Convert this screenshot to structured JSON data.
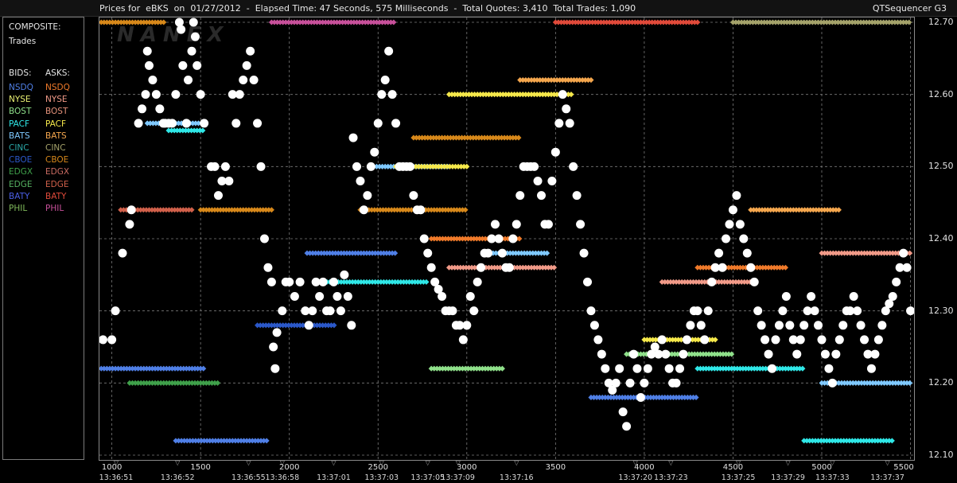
{
  "title": {
    "left": "Prices for  eBKS  on  01/27/2012  -  Elapsed Time: 47 Seconds, 575 Milliseconds  -  Total Quotes: 3,410  Total Trades: 1,090",
    "right": "QTSequencer G3"
  },
  "legend": {
    "composite_label": "COMPOSITE:",
    "trades_label": "Trades",
    "bids_header": "BIDS:",
    "asks_header": "ASKS:",
    "exchanges": [
      {
        "bid": "NSDQ",
        "ask": "NSDQ",
        "bid_color": "#4f7fe6",
        "ask_color": "#f07a2a"
      },
      {
        "bid": "NYSE",
        "ask": "NYSE",
        "bid_color": "#e9ef72",
        "ask_color": "#f19a88"
      },
      {
        "bid": "BOST",
        "ask": "BOST",
        "bid_color": "#8fe08a",
        "ask_color": "#e4917a"
      },
      {
        "bid": "PACF",
        "ask": "PACF",
        "bid_color": "#2fe7e7",
        "ask_color": "#f5e84a"
      },
      {
        "bid": "BATS",
        "ask": "BATS",
        "bid_color": "#7fc9ff",
        "ask_color": "#f4a64d"
      },
      {
        "bid": "CINC",
        "ask": "CINC",
        "bid_color": "#2aa6a6",
        "ask_color": "#a4a26a"
      },
      {
        "bid": "CBOE",
        "ask": "CBOE",
        "bid_color": "#2b58c9",
        "ask_color": "#d7881a"
      },
      {
        "bid": "EDGX",
        "ask": "EDGX",
        "bid_color": "#3fa04a",
        "ask_color": "#c96b62"
      },
      {
        "bid": "EDGE",
        "ask": "EDGE",
        "bid_color": "#55b060",
        "ask_color": "#d0604a"
      },
      {
        "bid": "BATY",
        "ask": "BATY",
        "bid_color": "#4a5fe6",
        "ask_color": "#e04a3a"
      },
      {
        "bid": "PHIL",
        "ask": "PHIL",
        "bid_color": "#7fb85a",
        "ask_color": "#c7509a"
      }
    ]
  },
  "chart_data": {
    "type": "scatter",
    "title": "",
    "y_tick_labels": [
      "12.70",
      "12.60",
      "12.50",
      "12.40",
      "12.30",
      "12.20",
      "12.10"
    ],
    "ylim": [
      12.1,
      12.7
    ],
    "xlim": [
      930,
      5520
    ],
    "x_ticks": [
      1000,
      1500,
      2000,
      2500,
      3000,
      3500,
      4000,
      4500,
      5000,
      5500
    ],
    "x_tick_labels": [
      "1000",
      "1500",
      "2000",
      "2500",
      "3000",
      "3500",
      "4000",
      "4500",
      "5000",
      "5500"
    ],
    "time_labels": [
      {
        "x": 1000,
        "label": "13:36:51"
      },
      {
        "x": 1370,
        "label": "13:36:52"
      },
      {
        "x": 1770,
        "label": "13:36:55"
      },
      {
        "x": 1960,
        "label": "13:36:58"
      },
      {
        "x": 2250,
        "label": "13:37:01"
      },
      {
        "x": 2520,
        "label": "13:37:03"
      },
      {
        "x": 2780,
        "label": "13:37:05"
      },
      {
        "x": 2950,
        "label": "13:37:09"
      },
      {
        "x": 3280,
        "label": "13:37:16"
      },
      {
        "x": 3950,
        "label": "13:37:20"
      },
      {
        "x": 4150,
        "label": "13:37:23"
      },
      {
        "x": 4530,
        "label": "13:37:25"
      },
      {
        "x": 4810,
        "label": "13:37:29"
      },
      {
        "x": 5060,
        "label": "13:37:33"
      },
      {
        "x": 5370,
        "label": "13:37:37"
      }
    ],
    "grid": true,
    "legend_placement": "left-panel",
    "trade_color": "#ffffff",
    "trades": [
      [
        950,
        12.26
      ],
      [
        1000,
        12.26
      ],
      [
        1020,
        12.3
      ],
      [
        1060,
        12.38
      ],
      [
        1100,
        12.42
      ],
      [
        1110,
        12.44
      ],
      [
        1150,
        12.56
      ],
      [
        1170,
        12.58
      ],
      [
        1190,
        12.6
      ],
      [
        1200,
        12.66
      ],
      [
        1210,
        12.64
      ],
      [
        1230,
        12.62
      ],
      [
        1250,
        12.6
      ],
      [
        1270,
        12.58
      ],
      [
        1290,
        12.56
      ],
      [
        1300,
        12.56
      ],
      [
        1320,
        12.56
      ],
      [
        1340,
        12.56
      ],
      [
        1360,
        12.6
      ],
      [
        1380,
        12.7
      ],
      [
        1390,
        12.69
      ],
      [
        1400,
        12.64
      ],
      [
        1420,
        12.56
      ],
      [
        1430,
        12.62
      ],
      [
        1450,
        12.66
      ],
      [
        1460,
        12.7
      ],
      [
        1470,
        12.68
      ],
      [
        1480,
        12.64
      ],
      [
        1500,
        12.6
      ],
      [
        1520,
        12.56
      ],
      [
        1560,
        12.5
      ],
      [
        1580,
        12.5
      ],
      [
        1600,
        12.46
      ],
      [
        1620,
        12.48
      ],
      [
        1640,
        12.5
      ],
      [
        1660,
        12.48
      ],
      [
        1680,
        12.6
      ],
      [
        1700,
        12.56
      ],
      [
        1720,
        12.6
      ],
      [
        1740,
        12.62
      ],
      [
        1760,
        12.64
      ],
      [
        1780,
        12.66
      ],
      [
        1800,
        12.62
      ],
      [
        1820,
        12.56
      ],
      [
        1840,
        12.5
      ],
      [
        1860,
        12.4
      ],
      [
        1880,
        12.36
      ],
      [
        1900,
        12.34
      ],
      [
        1910,
        12.25
      ],
      [
        1920,
        12.22
      ],
      [
        1930,
        12.27
      ],
      [
        1960,
        12.3
      ],
      [
        1980,
        12.34
      ],
      [
        2000,
        12.34
      ],
      [
        2030,
        12.32
      ],
      [
        2060,
        12.34
      ],
      [
        2090,
        12.3
      ],
      [
        2110,
        12.28
      ],
      [
        2130,
        12.3
      ],
      [
        2150,
        12.34
      ],
      [
        2170,
        12.32
      ],
      [
        2190,
        12.34
      ],
      [
        2210,
        12.3
      ],
      [
        2230,
        12.3
      ],
      [
        2250,
        12.34
      ],
      [
        2270,
        12.32
      ],
      [
        2290,
        12.3
      ],
      [
        2310,
        12.35
      ],
      [
        2330,
        12.32
      ],
      [
        2350,
        12.28
      ],
      [
        2360,
        12.54
      ],
      [
        2380,
        12.5
      ],
      [
        2400,
        12.48
      ],
      [
        2420,
        12.44
      ],
      [
        2440,
        12.46
      ],
      [
        2460,
        12.5
      ],
      [
        2480,
        12.52
      ],
      [
        2500,
        12.56
      ],
      [
        2520,
        12.6
      ],
      [
        2540,
        12.62
      ],
      [
        2560,
        12.66
      ],
      [
        2580,
        12.6
      ],
      [
        2600,
        12.56
      ],
      [
        2620,
        12.5
      ],
      [
        2640,
        12.5
      ],
      [
        2660,
        12.5
      ],
      [
        2680,
        12.5
      ],
      [
        2700,
        12.46
      ],
      [
        2720,
        12.44
      ],
      [
        2740,
        12.44
      ],
      [
        2760,
        12.4
      ],
      [
        2780,
        12.38
      ],
      [
        2800,
        12.36
      ],
      [
        2820,
        12.34
      ],
      [
        2840,
        12.33
      ],
      [
        2860,
        12.32
      ],
      [
        2880,
        12.3
      ],
      [
        2900,
        12.3
      ],
      [
        2920,
        12.3
      ],
      [
        2940,
        12.28
      ],
      [
        2960,
        12.28
      ],
      [
        2980,
        12.26
      ],
      [
        3000,
        12.28
      ],
      [
        3020,
        12.32
      ],
      [
        3040,
        12.3
      ],
      [
        3060,
        12.34
      ],
      [
        3080,
        12.36
      ],
      [
        3100,
        12.38
      ],
      [
        3120,
        12.38
      ],
      [
        3140,
        12.4
      ],
      [
        3160,
        12.42
      ],
      [
        3180,
        12.4
      ],
      [
        3200,
        12.38
      ],
      [
        3220,
        12.36
      ],
      [
        3240,
        12.36
      ],
      [
        3260,
        12.4
      ],
      [
        3280,
        12.42
      ],
      [
        3300,
        12.46
      ],
      [
        3320,
        12.5
      ],
      [
        3340,
        12.5
      ],
      [
        3360,
        12.5
      ],
      [
        3380,
        12.5
      ],
      [
        3400,
        12.48
      ],
      [
        3420,
        12.46
      ],
      [
        3440,
        12.42
      ],
      [
        3460,
        12.42
      ],
      [
        3480,
        12.48
      ],
      [
        3500,
        12.52
      ],
      [
        3520,
        12.56
      ],
      [
        3540,
        12.6
      ],
      [
        3560,
        12.58
      ],
      [
        3580,
        12.56
      ],
      [
        3600,
        12.5
      ],
      [
        3620,
        12.46
      ],
      [
        3640,
        12.42
      ],
      [
        3660,
        12.38
      ],
      [
        3680,
        12.34
      ],
      [
        3700,
        12.3
      ],
      [
        3720,
        12.28
      ],
      [
        3740,
        12.26
      ],
      [
        3760,
        12.24
      ],
      [
        3780,
        12.22
      ],
      [
        3800,
        12.2
      ],
      [
        3820,
        12.19
      ],
      [
        3840,
        12.2
      ],
      [
        3860,
        12.22
      ],
      [
        3880,
        12.16
      ],
      [
        3900,
        12.14
      ],
      [
        3920,
        12.2
      ],
      [
        3940,
        12.24
      ],
      [
        3960,
        12.22
      ],
      [
        3980,
        12.18
      ],
      [
        4000,
        12.2
      ],
      [
        4020,
        12.22
      ],
      [
        4040,
        12.24
      ],
      [
        4060,
        12.25
      ],
      [
        4080,
        12.24
      ],
      [
        4100,
        12.26
      ],
      [
        4120,
        12.24
      ],
      [
        4140,
        12.22
      ],
      [
        4160,
        12.2
      ],
      [
        4180,
        12.2
      ],
      [
        4200,
        12.22
      ],
      [
        4220,
        12.24
      ],
      [
        4240,
        12.26
      ],
      [
        4260,
        12.28
      ],
      [
        4280,
        12.3
      ],
      [
        4300,
        12.3
      ],
      [
        4320,
        12.28
      ],
      [
        4340,
        12.26
      ],
      [
        4360,
        12.3
      ],
      [
        4380,
        12.34
      ],
      [
        4400,
        12.36
      ],
      [
        4420,
        12.38
      ],
      [
        4440,
        12.36
      ],
      [
        4460,
        12.4
      ],
      [
        4480,
        12.42
      ],
      [
        4500,
        12.44
      ],
      [
        4520,
        12.46
      ],
      [
        4540,
        12.42
      ],
      [
        4560,
        12.4
      ],
      [
        4580,
        12.38
      ],
      [
        4600,
        12.36
      ],
      [
        4620,
        12.34
      ],
      [
        4640,
        12.3
      ],
      [
        4660,
        12.28
      ],
      [
        4680,
        12.26
      ],
      [
        4700,
        12.24
      ],
      [
        4720,
        12.22
      ],
      [
        4740,
        12.26
      ],
      [
        4760,
        12.28
      ],
      [
        4780,
        12.3
      ],
      [
        4800,
        12.32
      ],
      [
        4820,
        12.28
      ],
      [
        4840,
        12.26
      ],
      [
        4860,
        12.24
      ],
      [
        4880,
        12.26
      ],
      [
        4900,
        12.28
      ],
      [
        4920,
        12.3
      ],
      [
        4940,
        12.32
      ],
      [
        4960,
        12.3
      ],
      [
        4980,
        12.28
      ],
      [
        5000,
        12.26
      ],
      [
        5020,
        12.24
      ],
      [
        5040,
        12.22
      ],
      [
        5060,
        12.2
      ],
      [
        5080,
        12.24
      ],
      [
        5100,
        12.26
      ],
      [
        5120,
        12.28
      ],
      [
        5140,
        12.3
      ],
      [
        5160,
        12.3
      ],
      [
        5180,
        12.32
      ],
      [
        5200,
        12.3
      ],
      [
        5220,
        12.28
      ],
      [
        5240,
        12.26
      ],
      [
        5260,
        12.24
      ],
      [
        5280,
        12.22
      ],
      [
        5300,
        12.24
      ],
      [
        5320,
        12.26
      ],
      [
        5340,
        12.28
      ],
      [
        5360,
        12.3
      ],
      [
        5380,
        12.31
      ],
      [
        5400,
        12.32
      ],
      [
        5420,
        12.34
      ],
      [
        5440,
        12.36
      ],
      [
        5460,
        12.38
      ],
      [
        5480,
        12.36
      ],
      [
        5500,
        12.3
      ]
    ],
    "bid_bands": [
      {
        "exchange": "NSDQ",
        "x0": 940,
        "x1": 1520,
        "y": 12.22,
        "color": "#4f7fe6"
      },
      {
        "exchange": "NSDQ",
        "x0": 1360,
        "x1": 1880,
        "y": 12.12,
        "color": "#4f7fe6"
      },
      {
        "exchange": "PACF",
        "x0": 1320,
        "x1": 1520,
        "y": 12.55,
        "color": "#2fe7e7"
      },
      {
        "exchange": "BATS",
        "x0": 1200,
        "x1": 1500,
        "y": 12.56,
        "color": "#7fc9ff"
      },
      {
        "exchange": "CBOE",
        "x0": 1820,
        "x1": 2260,
        "y": 12.28,
        "color": "#2b58c9"
      },
      {
        "exchange": "PACF",
        "x0": 2180,
        "x1": 2780,
        "y": 12.34,
        "color": "#2fe7e7"
      },
      {
        "exchange": "NSDQ",
        "x0": 2100,
        "x1": 2600,
        "y": 12.38,
        "color": "#4f7fe6"
      },
      {
        "exchange": "BATS",
        "x0": 2460,
        "x1": 2900,
        "y": 12.5,
        "color": "#7fc9ff"
      },
      {
        "exchange": "BOST",
        "x0": 2800,
        "x1": 3200,
        "y": 12.22,
        "color": "#8fe08a"
      },
      {
        "exchange": "BATS",
        "x0": 3100,
        "x1": 3460,
        "y": 12.38,
        "color": "#7fc9ff"
      },
      {
        "exchange": "NSDQ",
        "x0": 3700,
        "x1": 4300,
        "y": 12.18,
        "color": "#4f7fe6"
      },
      {
        "exchange": "BOST",
        "x0": 3900,
        "x1": 4500,
        "y": 12.24,
        "color": "#8fe08a"
      },
      {
        "exchange": "PACF",
        "x0": 4300,
        "x1": 4900,
        "y": 12.22,
        "color": "#2fe7e7"
      },
      {
        "exchange": "PACF",
        "x0": 4900,
        "x1": 5400,
        "y": 12.12,
        "color": "#2fe7e7"
      },
      {
        "exchange": "BATS",
        "x0": 5000,
        "x1": 5500,
        "y": 12.2,
        "color": "#7fc9ff"
      },
      {
        "exchange": "EDGX",
        "x0": 1100,
        "x1": 1600,
        "y": 12.2,
        "color": "#3fa04a"
      }
    ],
    "ask_bands": [
      {
        "exchange": "CBOE",
        "x0": 940,
        "x1": 1300,
        "y": 12.7,
        "color": "#d7881a"
      },
      {
        "exchange": "PHIL",
        "x0": 1900,
        "x1": 2600,
        "y": 12.7,
        "color": "#c7509a"
      },
      {
        "exchange": "BATY",
        "x0": 3500,
        "x1": 4300,
        "y": 12.7,
        "color": "#e04a3a"
      },
      {
        "exchange": "CINC",
        "x0": 4500,
        "x1": 5500,
        "y": 12.7,
        "color": "#a4a26a"
      },
      {
        "exchange": "PACF",
        "x0": 2900,
        "x1": 3600,
        "y": 12.6,
        "color": "#f5e84a"
      },
      {
        "exchange": "BATS",
        "x0": 3300,
        "x1": 3700,
        "y": 12.62,
        "color": "#f4a64d"
      },
      {
        "exchange": "CBOE",
        "x0": 2700,
        "x1": 3300,
        "y": 12.54,
        "color": "#d7881a"
      },
      {
        "exchange": "PACF",
        "x0": 2600,
        "x1": 3000,
        "y": 12.5,
        "color": "#f5e84a"
      },
      {
        "exchange": "CBOE",
        "x0": 2400,
        "x1": 3000,
        "y": 12.44,
        "color": "#d7881a"
      },
      {
        "exchange": "NSDQ",
        "x0": 2800,
        "x1": 3300,
        "y": 12.4,
        "color": "#f07a2a"
      },
      {
        "exchange": "NYSE",
        "x0": 2900,
        "x1": 3500,
        "y": 12.36,
        "color": "#f19a88"
      },
      {
        "exchange": "PACF",
        "x0": 4000,
        "x1": 4400,
        "y": 12.26,
        "color": "#f5e84a"
      },
      {
        "exchange": "NYSE",
        "x0": 4100,
        "x1": 4600,
        "y": 12.34,
        "color": "#f19a88"
      },
      {
        "exchange": "NSDQ",
        "x0": 4300,
        "x1": 4800,
        "y": 12.36,
        "color": "#f07a2a"
      },
      {
        "exchange": "NYSE",
        "x0": 5000,
        "x1": 5500,
        "y": 12.38,
        "color": "#f19a88"
      },
      {
        "exchange": "BATS",
        "x0": 4600,
        "x1": 5100,
        "y": 12.44,
        "color": "#f4a64d"
      },
      {
        "exchange": "EDGE",
        "x0": 1050,
        "x1": 1450,
        "y": 12.44,
        "color": "#d0604a"
      },
      {
        "exchange": "CBOE",
        "x0": 1500,
        "x1": 1900,
        "y": 12.44,
        "color": "#d7881a"
      }
    ]
  }
}
